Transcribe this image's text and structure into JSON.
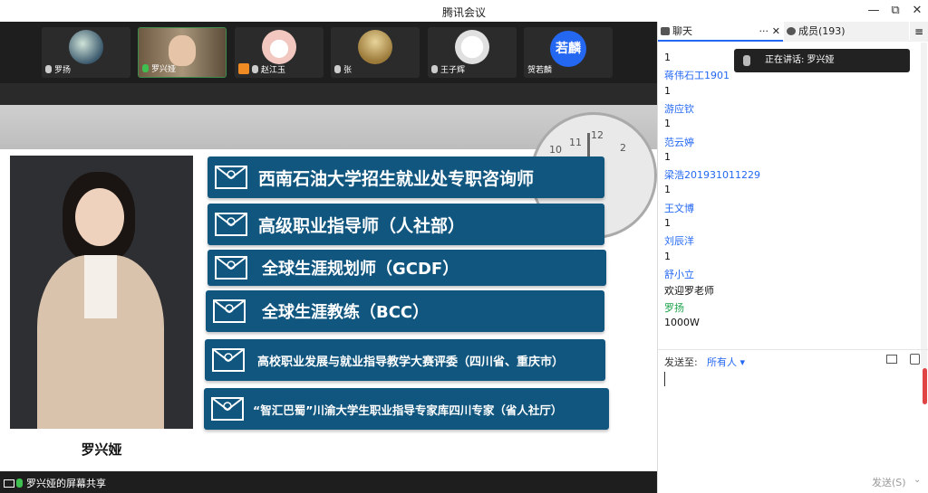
{
  "window": {
    "title": "腾讯会议",
    "min": "—",
    "max": "⧉",
    "close": "✕"
  },
  "participants": [
    {
      "name": "罗扬",
      "type": "photo",
      "color": "#3c5a6e"
    },
    {
      "name": "罗兴娅",
      "type": "video",
      "color": "#7a6a55"
    },
    {
      "name": "赵江玉",
      "type": "photo",
      "color": "#f2c7c0"
    },
    {
      "name": "张",
      "type": "photo",
      "color": "#9b7a3a"
    },
    {
      "name": "王子辉",
      "type": "photo",
      "color": "#f3f3f3"
    },
    {
      "name": "贺若麟",
      "type": "badge",
      "badge": "若麟",
      "color": "#2468f2"
    }
  ],
  "slide": {
    "speaker_name": "罗兴娅",
    "credentials": [
      "西南石油大学招生就业处专职咨询师",
      "高级职业指导师（人社部）",
      "全球生涯规划师（GCDF）",
      "全球生涯教练（BCC）",
      "高校职业发展与就业指导教学大赛评委（四川省、重庆市）",
      "“智汇巴蜀”川渝大学生职业指导专家库四川专家（省人社厅）"
    ]
  },
  "share_label": "罗兴娅的屏幕共享",
  "panel": {
    "tab_chat": "聊天",
    "tab_more": "···",
    "tab_close": "✕",
    "tab_members": "成员(193)",
    "menu": "≡",
    "speaking": "正在讲话: 罗兴娅",
    "messages": [
      {
        "kind": "tx",
        "text": "1"
      },
      {
        "kind": "nm",
        "text": "蒋伟石工1901"
      },
      {
        "kind": "tx",
        "text": "1"
      },
      {
        "kind": "nm",
        "text": "游应钦"
      },
      {
        "kind": "tx",
        "text": "1"
      },
      {
        "kind": "nm",
        "text": "范云婷"
      },
      {
        "kind": "tx",
        "text": "1"
      },
      {
        "kind": "nm",
        "text": "梁浩201931011229"
      },
      {
        "kind": "tx",
        "text": "1"
      },
      {
        "kind": "nm",
        "text": "王文博"
      },
      {
        "kind": "tx",
        "text": "1"
      },
      {
        "kind": "nm",
        "text": "刘辰洋"
      },
      {
        "kind": "tx",
        "text": "1"
      },
      {
        "kind": "nm",
        "text": "舒小立"
      },
      {
        "kind": "tx",
        "text": "欢迎罗老师"
      },
      {
        "kind": "nm green",
        "text": "罗扬"
      },
      {
        "kind": "tx",
        "text": "1000W"
      }
    ],
    "send_to_label": "发送至:",
    "send_to_value": "所有人 ▾",
    "send_button": "发送(S)",
    "send_arrow": "⌄"
  }
}
